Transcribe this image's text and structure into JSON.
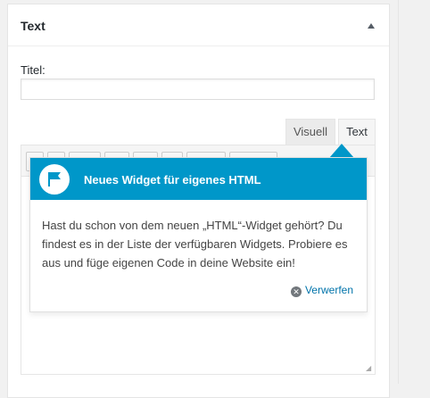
{
  "widget": {
    "title": "Text",
    "field_label": "Titel:",
    "title_value": ""
  },
  "editor": {
    "tab_visual": "Visuell",
    "tab_text": "Text"
  },
  "pointer": {
    "title": "Neues Widget für eigenes HTML",
    "body": "Hast du schon von dem neuen „HTML“-Widget gehört? Du findest es in der Liste der verfügbaren Widgets. Probiere es aus und füge eigenen Code in deine Website ein!",
    "dismiss_label": "Verwerfen",
    "header_color": "#0097c9"
  },
  "icons": {
    "toggle": "collapse-arrow-up-icon",
    "flag": "flag-icon",
    "dismiss": "close-circle-icon",
    "resize": "resize-grip-icon"
  }
}
